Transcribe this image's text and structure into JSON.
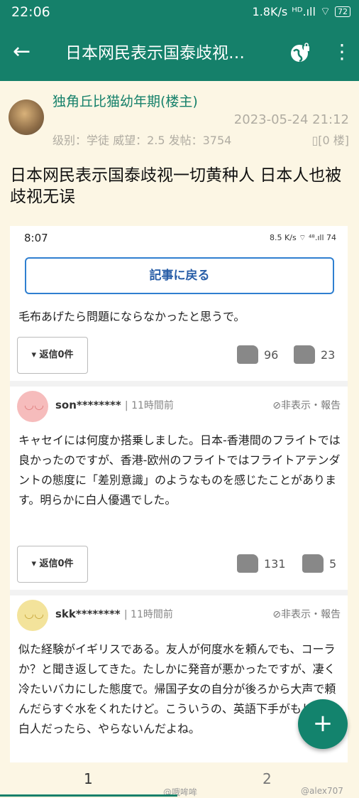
{
  "status_bar": {
    "time": "22:06",
    "speed": "1.8K/s",
    "battery": "72"
  },
  "app_bar": {
    "title": "日本网民表示国泰歧视…"
  },
  "post": {
    "author": "独角丘比猫幼年期(楼主)",
    "date": "2023-05-24 21:12",
    "meta": "级别：学徒   威望：2.5   发帖：3754",
    "floor": "▯[0 楼]",
    "title": "日本网民表示国泰歧视一切黄种人 日本人也被歧视无误"
  },
  "screenshot": {
    "time": "8:07",
    "status_right": "8.5 K/s  ⌔ ⁴⁸.ıll 74",
    "back_button": "記事に戻る",
    "comments": [
      {
        "text": "毛布あげたら問題にならなかったと思うで。",
        "reply": "▾ 返信0件",
        "likes": "96",
        "dislikes": "23"
      },
      {
        "user": "son********",
        "ago": "| 11時間前",
        "hide": "⊘非表示・報告",
        "text": "キャセイには何度か搭乗しました。日本-香港間のフライトでは良かったのですが、香港-欧州のフライトではフライトアテンダントの態度に「差別意識」のようなものを感じたことがあります。明らかに白人優遇でした。",
        "reply": "▾ 返信0件",
        "likes": "131",
        "dislikes": "5"
      },
      {
        "user": "skk********",
        "ago": "| 11時間前",
        "hide": "⊘非表示・報告",
        "text": "似た経験がイギリスである。友人が何度水を頼んでも、コーラか？と聞き返してきた。たしかに発音が悪かったですが、凄く冷たいバカにした態度で。帰国子女の自分が後ろから大声で頼んだらすぐ水をくれたけど。こういうの、英語下手がもし同じ白人だったら、やらないんだよね。"
      }
    ]
  },
  "pager": {
    "page1": "1",
    "page2": "2"
  },
  "watermarks": {
    "left": "@哦哞哞",
    "right": "@alex707"
  },
  "fab_label": "+",
  "colors": {
    "accent": "#15806a",
    "background": "#fcf6e4"
  }
}
